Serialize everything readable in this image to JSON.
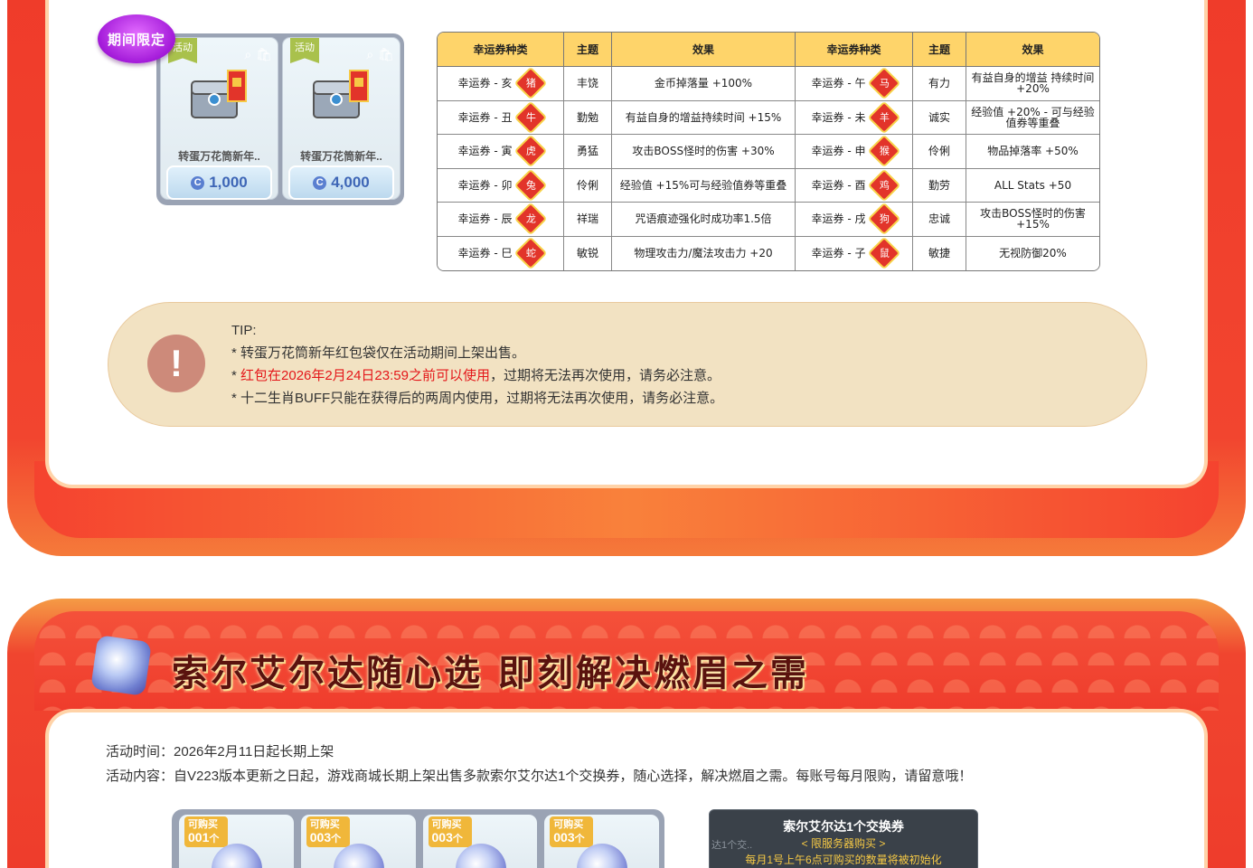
{
  "shop_top": {
    "limited_badge": "期间限定",
    "items": [
      {
        "tag": "活动",
        "name": "转蛋万花筒新年..",
        "price": "1,000",
        "currency_icon": "c-coin-icon"
      },
      {
        "tag": "活动",
        "name": "转蛋万花筒新年..",
        "price": "4,000",
        "currency_icon": "c-coin-icon"
      }
    ]
  },
  "lucky_table": {
    "headers": [
      "幸运券种类",
      "主题",
      "效果",
      "幸运券种类",
      "主题",
      "效果"
    ],
    "rows": [
      {
        "t1": "幸运券 - 亥",
        "i1": "猪",
        "th1": "丰饶",
        "e1": "金币掉落量 +100%",
        "t2": "幸运券 - 午",
        "i2": "马",
        "th2": "有力",
        "e2": "有益自身的增益 持续时间 +20%"
      },
      {
        "t1": "幸运券 - 丑",
        "i1": "牛",
        "th1": "勤勉",
        "e1": "有益自身的增益持续时间 +15%",
        "t2": "幸运券 - 未",
        "i2": "羊",
        "th2": "诚实",
        "e2": "经验值 +20% - 可与经验值券等重叠"
      },
      {
        "t1": "幸运券 - 寅",
        "i1": "虎",
        "th1": "勇猛",
        "e1": "攻击BOSS怪时的伤害 +30%",
        "t2": "幸运券 - 申",
        "i2": "猴",
        "th2": "伶俐",
        "e2": "物品掉落率 +50%"
      },
      {
        "t1": "幸运券 - 卯",
        "i1": "兔",
        "th1": "伶俐",
        "e1": "经验值 +15%可与经验值券等重叠",
        "t2": "幸运券 - 酉",
        "i2": "鸡",
        "th2": "勤劳",
        "e2": "ALL Stats +50"
      },
      {
        "t1": "幸运券 - 辰",
        "i1": "龙",
        "th1": "祥瑞",
        "e1": "咒语痕迹强化时成功率1.5倍",
        "t2": "幸运券 - 戌",
        "i2": "狗",
        "th2": "忠诚",
        "e2": "攻击BOSS怪时的伤害 +15%"
      },
      {
        "t1": "幸运券 - 巳",
        "i1": "蛇",
        "th1": "敏锐",
        "e1": "物理攻击力/魔法攻击力 +20",
        "t2": "幸运券 - 子",
        "i2": "鼠",
        "th2": "敏捷",
        "e2": "无视防御20%"
      }
    ]
  },
  "tip": {
    "icon": "exclamation-icon",
    "heading": "TIP:",
    "line1": "* 转蛋万花筒新年红包袋仅在活动期间上架出售。",
    "line2_prefix": "*  ",
    "line2_red": "红包在2026年2月24日23:59之前可以使用",
    "line2_rest": "，过期将无法再次使用，请务必注意。",
    "line3": "* 十二生肖BUFF只能在获得后的两周内使用，过期将无法再次使用，请务必注意。"
  },
  "section2": {
    "title": "索尔艾尔达随心选 即刻解决燃眉之需",
    "time_label": "活动时间：",
    "time_value": "2026年2月11日起长期上架",
    "content_label": "活动内容：",
    "content_value": "自V223版本更新之日起，游戏商城长期上架出售多款索尔艾尔达1个交换券，随心选择，解决燃眉之需。每账号每月限购，请留意哦！",
    "items": [
      {
        "buy_label": "可购买",
        "count": "001",
        "unit": "个"
      },
      {
        "buy_label": "可购买",
        "count": "003",
        "unit": "个"
      },
      {
        "buy_label": "可购买",
        "count": "003",
        "unit": "个"
      },
      {
        "buy_label": "可购买",
        "count": "003",
        "unit": "个"
      }
    ],
    "tooltip": {
      "title": "索尔艾尔达1个交换券",
      "subtitle": "< 限服务器购买 >",
      "note": "每月1号上午6点可购买的数量将被初始化",
      "ghost": "达1个交.."
    }
  },
  "colors": {
    "frame_red": "#ef3b2a",
    "table_header": "#fed46a",
    "tip_bg": "#f2e2c2",
    "tip_red": "#e4171a",
    "price_blue": "#3e66b6"
  }
}
